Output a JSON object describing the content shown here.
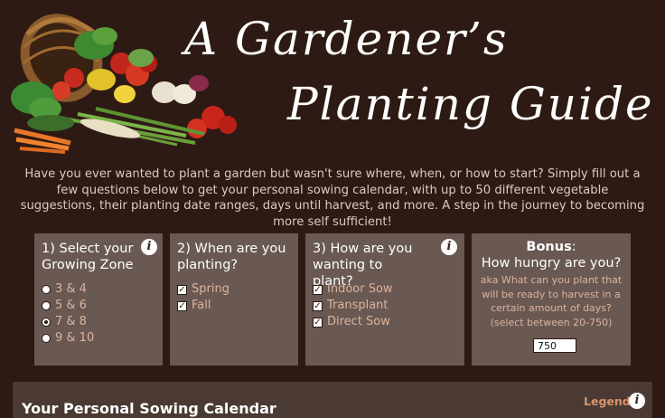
{
  "header": {
    "title_line1": "A Gardener’s",
    "title_line2": "Planting Guide"
  },
  "intro": "Have you ever wanted to plant a garden but wasn't sure where, when, or how to start? Simply fill out a few questions below to get your personal sowing calendar, with up to 50 different vegetable suggestions, their planting date ranges, days until harvest, and more. A step in the journey to becoming more self sufficient!",
  "zone_card": {
    "heading": "1) Select your Growing Zone",
    "options": [
      "3 & 4",
      "5 & 6",
      "7 & 8",
      "9 & 10"
    ],
    "selected": "7 & 8"
  },
  "when_card": {
    "heading": "2) When are you planting?",
    "options": [
      "Spring",
      "Fall"
    ],
    "checked": [
      "Spring",
      "Fall"
    ]
  },
  "how_card": {
    "heading": "3) How are you wanting to plant?",
    "options": [
      "Indoor Sow",
      "Transplant",
      "Direct Sow"
    ],
    "checked": [
      "Indoor Sow",
      "Transplant",
      "Direct Sow"
    ]
  },
  "bonus_card": {
    "label": "Bonus",
    "subtitle": "How hungry are you?",
    "description": "aka What can you plant that will be ready to harvest in a certain amount of days? (select between 20-750)",
    "value": "750"
  },
  "calendar": {
    "title": "Your Personal Sowing Calendar",
    "legend_label": "Legend"
  },
  "icons": {
    "info": "i"
  },
  "colors": {
    "background": "#2e1a14",
    "card": "#695952",
    "accent_text": "#dcb39e",
    "legend": "#d9926c"
  }
}
